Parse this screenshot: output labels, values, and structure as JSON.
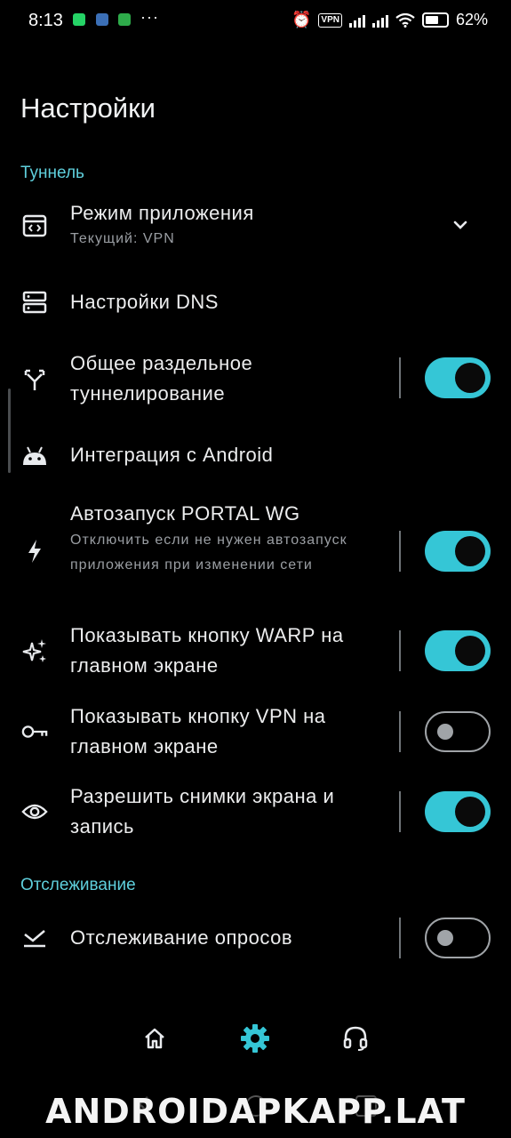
{
  "status_bar": {
    "time": "8:13",
    "more": "···",
    "vpn": "VPN",
    "battery": "62%"
  },
  "page": {
    "title": "Настройки"
  },
  "sections": {
    "tunnel": "Туннель",
    "tracking": "Отслеживание"
  },
  "items": {
    "app_mode": {
      "title": "Режим приложения",
      "subtitle": "Текущий: VPN",
      "icon": "code-window-icon"
    },
    "dns": {
      "title": "Настройки DNS",
      "icon": "server-icon"
    },
    "split": {
      "title": "Общее раздельное туннелирование",
      "icon": "split-arrows-icon",
      "enabled": true
    },
    "android": {
      "title": "Интеграция с Android",
      "icon": "android-icon"
    },
    "autostart": {
      "title": "Автозапуск PORTAL WG",
      "subtitle": "Отключить если не нужен автозапуск приложения при изменении сети",
      "icon": "lightning-icon",
      "enabled": true
    },
    "warp": {
      "title": "Показывать кнопку WARP на главном экране",
      "icon": "sparkle-icon",
      "enabled": true
    },
    "vpn_btn": {
      "title": "Показывать кнопку VPN на главном экране",
      "icon": "key-icon",
      "enabled": false
    },
    "screenshots": {
      "title": "Разрешить снимки экрана и запись",
      "icon": "eye-icon",
      "enabled": true
    },
    "polls": {
      "title": "Отслеживание опросов",
      "icon": "check-down-icon",
      "enabled": false
    }
  },
  "bottom_nav": [
    {
      "name": "home-icon"
    },
    {
      "name": "settings-gear-icon",
      "active": true
    },
    {
      "name": "headset-icon"
    }
  ],
  "watermark": "ANDROIDAPKAPP.LAT",
  "colors": {
    "accent": "#35c6d6",
    "background": "#000000"
  }
}
